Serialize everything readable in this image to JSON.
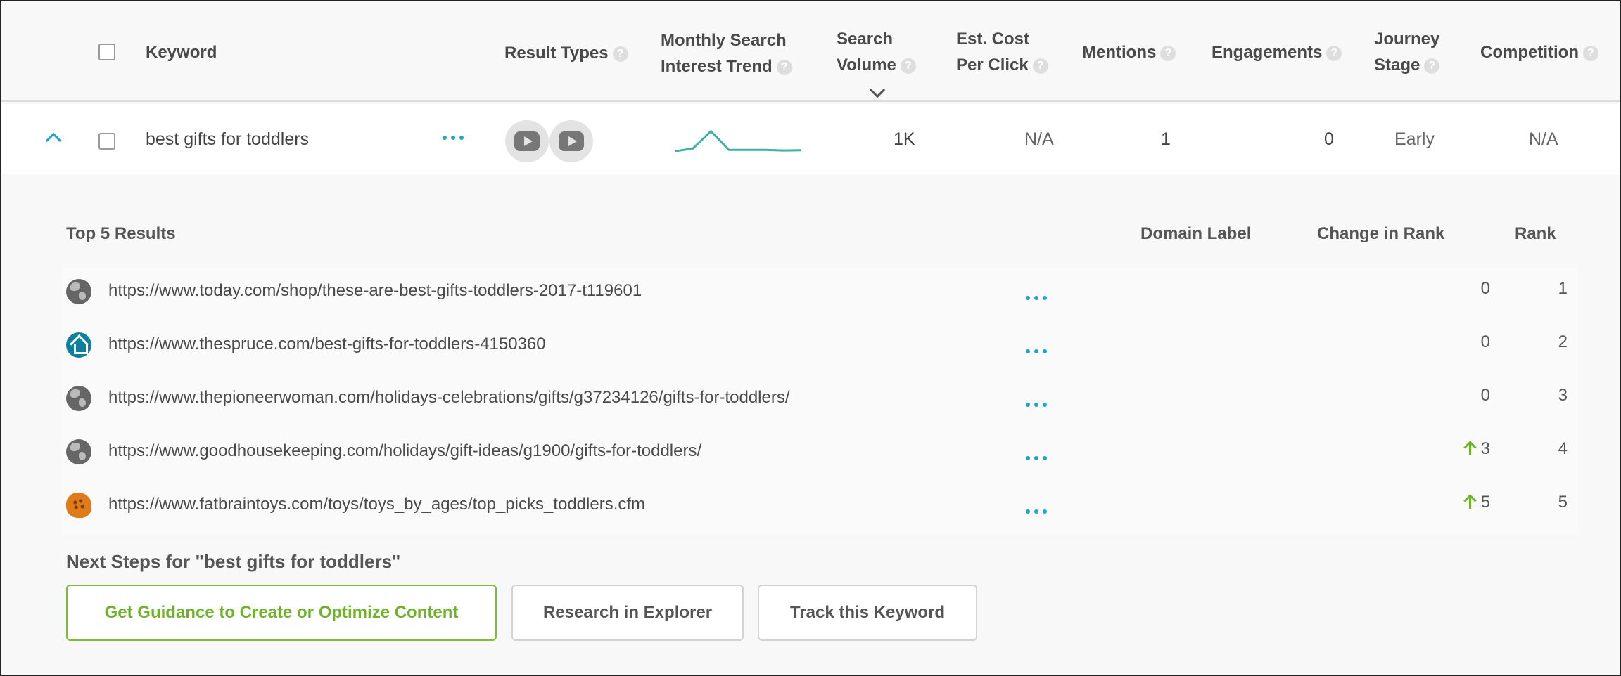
{
  "header": {
    "keyword": "Keyword",
    "result_types": "Result Types",
    "trend_line1": "Monthly Search",
    "trend_line2": "Interest Trend",
    "volume_line1": "Search",
    "volume_line2": "Volume",
    "cpc_line1": "Est. Cost",
    "cpc_line2": "Per Click",
    "mentions": "Mentions",
    "engagements": "Engagements",
    "journey_line1": "Journey",
    "journey_line2": "Stage",
    "competition": "Competition",
    "help_glyph": "?"
  },
  "keyword_row": {
    "keyword": "best gifts for toddlers",
    "result_type_icons": [
      "video-icon",
      "video-icon"
    ],
    "trend_values": [
      0.1,
      0.2,
      0.85,
      0.15,
      0.15,
      0.15,
      0.13,
      0.14
    ],
    "search_volume": "1K",
    "cpc": "N/A",
    "mentions": "1",
    "engagements": "0",
    "journey_stage": "Early",
    "competition": "N/A"
  },
  "results": {
    "title": "Top 5 Results",
    "col_domain_label": "Domain Label",
    "col_change": "Change in Rank",
    "col_rank": "Rank",
    "rows": [
      {
        "icon": "globe-icon",
        "url": "https://www.today.com/shop/these-are-best-gifts-toddlers-2017-t119601",
        "change": "0",
        "up": false,
        "rank": "1"
      },
      {
        "icon": "house-icon",
        "url": "https://www.thespruce.com/best-gifts-for-toddlers-4150360",
        "change": "0",
        "up": false,
        "rank": "2"
      },
      {
        "icon": "globe-icon",
        "url": "https://www.thepioneerwoman.com/holidays-celebrations/gifts/g37234126/gifts-for-toddlers/",
        "change": "0",
        "up": false,
        "rank": "3"
      },
      {
        "icon": "globe-icon",
        "url": "https://www.goodhousekeeping.com/holidays/gift-ideas/g1900/gifts-for-toddlers/",
        "change": "3",
        "up": true,
        "rank": "4"
      },
      {
        "icon": "brain-icon",
        "url": "https://www.fatbraintoys.com/toys/toys_by_ages/top_picks_toddlers.cfm",
        "change": "5",
        "up": true,
        "rank": "5"
      }
    ]
  },
  "next_steps": {
    "title": "Next Steps for \"best gifts for toddlers\"",
    "btn_guidance": "Get Guidance to Create or Optimize Content",
    "btn_research": "Research in Explorer",
    "btn_track": "Track this Keyword"
  },
  "colors": {
    "accent_teal": "#1aa6c7",
    "trend_line": "#3fb0a3",
    "positive_green": "#6fb22c"
  }
}
